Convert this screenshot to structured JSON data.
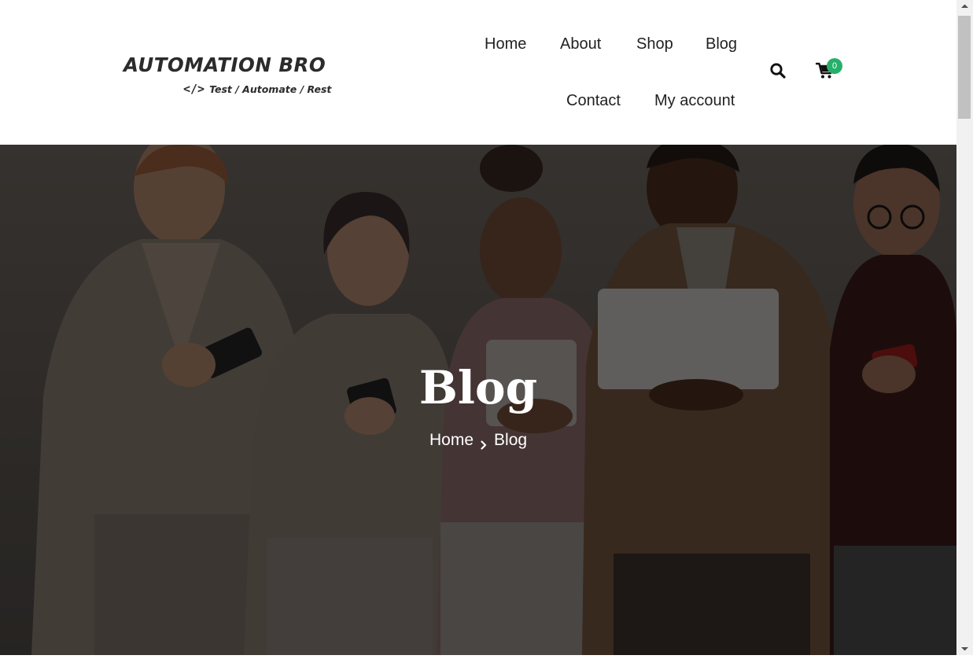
{
  "logo": {
    "title": "AUTOMATION BRO",
    "code_symbol": "</>",
    "tagline": "Test / Automate / Rest"
  },
  "nav": {
    "items": [
      {
        "label": "Home"
      },
      {
        "label": "About"
      },
      {
        "label": "Shop"
      },
      {
        "label": "Blog"
      },
      {
        "label": "Contact"
      },
      {
        "label": "My account"
      }
    ]
  },
  "header_actions": {
    "search_icon": "search-icon",
    "cart_icon": "cart-icon",
    "cart_count": "0",
    "badge_color": "#25b06a"
  },
  "hero": {
    "title": "Blog",
    "breadcrumb": {
      "home": "Home",
      "separator_icon": "chevron-right-icon",
      "current": "Blog"
    },
    "overlay_color": "#000000"
  }
}
